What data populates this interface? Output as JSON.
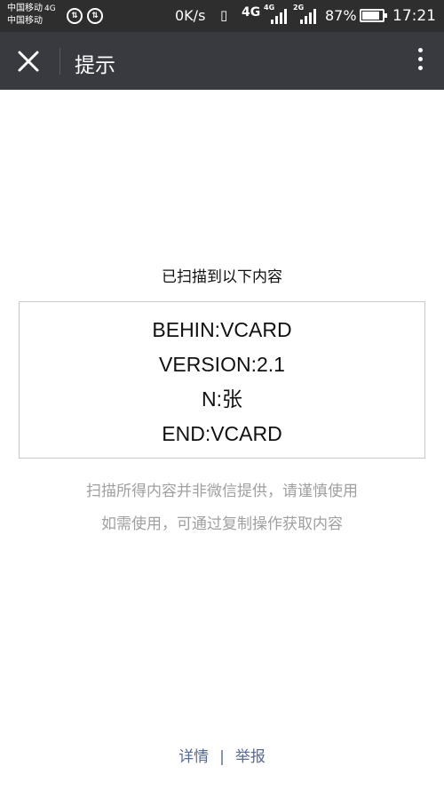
{
  "status_bar": {
    "carrier_1": "中国移动",
    "carrier_1_network": "4G",
    "carrier_2": "中国移动",
    "speed": "0K/s",
    "network_label": "4G",
    "network_label_sub": "4G",
    "network_label_2": "2G",
    "battery_percent": "87%",
    "battery_level": 0.87,
    "time": "17:21"
  },
  "header": {
    "title": "提示"
  },
  "main": {
    "heading": "已扫描到以下内容",
    "content_lines": [
      "BEHIN:VCARD",
      "VERSION:2.1",
      "N:张",
      "END:VCARD"
    ],
    "notice_line_1": "扫描所得内容并非微信提供，请谨慎使用",
    "notice_line_2": "如需使用，可通过复制操作获取内容"
  },
  "footer": {
    "details_link": "详情",
    "separator": "|",
    "report_link": "举报"
  }
}
